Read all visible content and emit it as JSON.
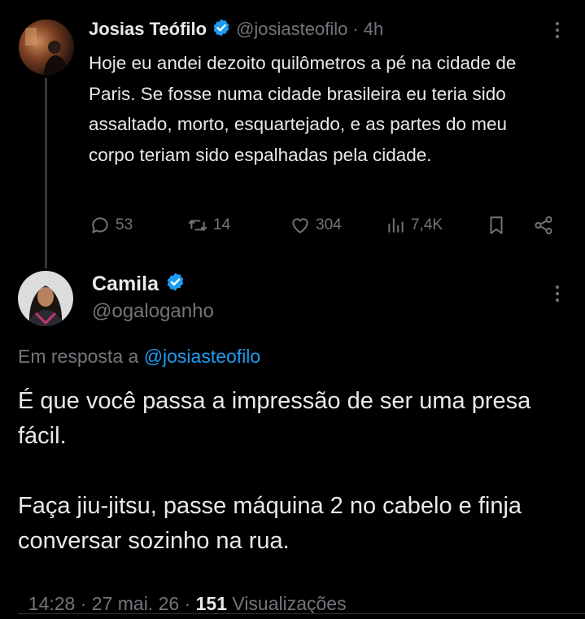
{
  "parent_tweet": {
    "author_name": "Josias Teófilo",
    "author_handle": "@josiasteofilo",
    "time_sep": "·",
    "time": "4h",
    "text": "Hoje eu andei dezoito quilômetros a pé na cidade de Paris. Se fosse numa cidade brasileira eu teria sido assaltado, morto, esquartejado, e as partes do meu corpo teriam sido espalhadas pela cidade.",
    "replies": "53",
    "reposts": "14",
    "likes": "304",
    "views": "7,4K"
  },
  "reply_tweet": {
    "author_name": "Camila",
    "author_handle": "@ogaloganho",
    "in_reply_label": "Em resposta a",
    "in_reply_handle": "@josiasteofilo",
    "text_p1": "É que você passa a impressão de ser uma presa fácil.",
    "text_p2": "Faça jiu-jitsu, passe máquina 2 no cabelo e finja conversar sozinho na rua.",
    "timestamp": "14:28 · 27 mai. 26 · ",
    "views_count": "151",
    "views_label": "Visualizações"
  },
  "colors": {
    "background": "#000000",
    "text": "#e7e9ea",
    "muted": "#71767b",
    "link": "#1d9bf0",
    "verified": "#1d9bf0"
  }
}
